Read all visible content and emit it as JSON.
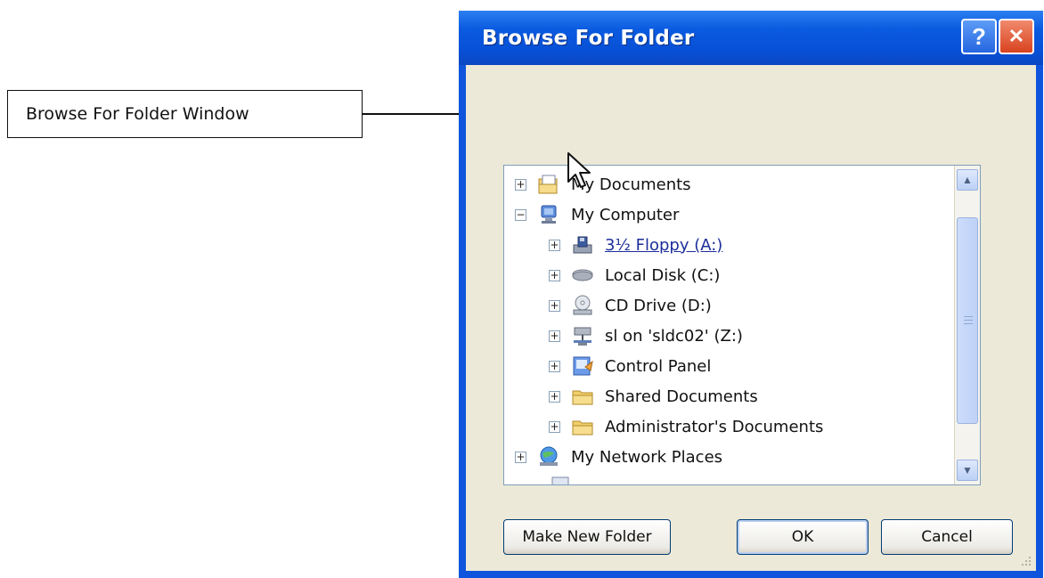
{
  "callout": {
    "label": "Browse For Folder Window"
  },
  "dialog": {
    "title": "Browse For Folder",
    "help_glyph": "?",
    "close_glyph": "✕"
  },
  "tree": {
    "items": [
      {
        "label": "My Documents",
        "icon": "my-documents-icon",
        "expander": "+"
      },
      {
        "label": "My Computer",
        "icon": "my-computer-icon",
        "expander": "−"
      },
      {
        "label": "3½ Floppy (A:)",
        "icon": "floppy-drive-icon",
        "expander": "+"
      },
      {
        "label": "Local Disk (C:)",
        "icon": "local-disk-icon",
        "expander": "+"
      },
      {
        "label": "CD Drive (D:)",
        "icon": "cd-drive-icon",
        "expander": "+"
      },
      {
        "label": "sl on 'sldc02' (Z:)",
        "icon": "network-drive-icon",
        "expander": "+"
      },
      {
        "label": "Control Panel",
        "icon": "control-panel-icon",
        "expander": "+"
      },
      {
        "label": "Shared Documents",
        "icon": "folder-icon",
        "expander": "+"
      },
      {
        "label": "Administrator's Documents",
        "icon": "folder-icon",
        "expander": "+"
      },
      {
        "label": "My Network Places",
        "icon": "network-places-icon",
        "expander": "+"
      }
    ]
  },
  "buttons": {
    "make_new_folder": "Make New Folder",
    "ok": "OK",
    "cancel": "Cancel"
  },
  "colors": {
    "title_bar": "#0a5ae0",
    "dialog_body": "#ece9d8",
    "tree_background": "#ffffff",
    "link_text": "#1d2e9a"
  }
}
